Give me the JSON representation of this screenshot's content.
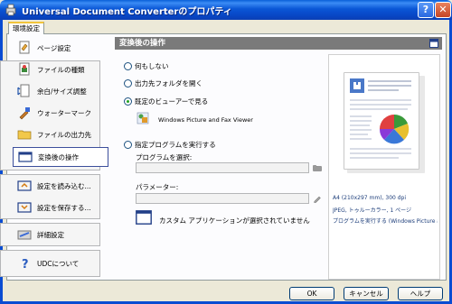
{
  "window": {
    "title": "Universal Document Converterのプロパティ",
    "help_button": "?",
    "close_button": "✕"
  },
  "tabs": [
    {
      "label": "環境設定"
    }
  ],
  "sidebar": {
    "items": [
      {
        "label": "ページ設定",
        "icon": "page-settings-icon"
      },
      {
        "label": "ファイルの種類",
        "icon": "file-type-icon"
      },
      {
        "label": "余白/サイズ調整",
        "icon": "margin-size-icon"
      },
      {
        "label": "ウォーターマーク",
        "icon": "watermark-icon"
      },
      {
        "label": "ファイルの出力先",
        "icon": "output-folder-icon"
      },
      {
        "label": "変換後の操作",
        "icon": "post-action-icon",
        "selected": true
      }
    ],
    "config_items": [
      {
        "label": "設定を読み込む...",
        "icon": "load-settings-icon"
      },
      {
        "label": "設定を保存する...",
        "icon": "save-settings-icon"
      }
    ],
    "advanced": {
      "label": "詳細設定",
      "icon": "advanced-settings-icon"
    },
    "about": {
      "label": "UDCについて",
      "icon": "help-icon"
    }
  },
  "main": {
    "header": "変換後の操作",
    "options": {
      "do_nothing": "何もしない",
      "open_folder": "出力先フォルダを開く",
      "default_viewer": "既定のビューアーで見る",
      "run_program": "指定プログラムを実行する"
    },
    "selected_option": "default_viewer",
    "viewer_name": "Windows Picture and Fax Viewer",
    "program_label": "プログラムを選択:",
    "program_value": "",
    "params_label": "パラメーター:",
    "params_value": "",
    "custom_app_text": "カスタム アプリケーションが選択されていません"
  },
  "preview": {
    "line1": "A4 (210x297 mm), 300 dpi",
    "line2": "JPEG, トゥルーカラー, 1 ページ",
    "line3": "プログラムを実行する (Windows Picture and"
  },
  "buttons": {
    "ok": "OK",
    "cancel": "キャンセル",
    "help": "ヘルプ"
  },
  "colors": {
    "title_bar": "#0a56d6",
    "header_bg": "#7a7a7a",
    "selected_border": "#3c4f9c",
    "tab_accent": "#f1c43b"
  }
}
